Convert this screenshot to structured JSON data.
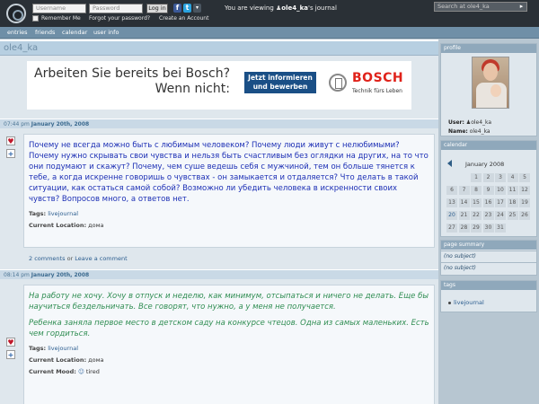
{
  "topbar": {
    "username_placeholder": "Username",
    "password_placeholder": "Password",
    "login_label": "Log in",
    "remember_label": "Remember Me",
    "forgot_label": "Forgot your password?",
    "create_label": "Create an Account",
    "viewing_prefix": "You are viewing",
    "viewing_user": "ole4_ka",
    "viewing_suffix": "'s journal",
    "search_placeholder": "Search at ole4_ka"
  },
  "nav": {
    "items": [
      "entries",
      "friends",
      "calendar",
      "user info"
    ]
  },
  "journal_title": "ole4_ka",
  "ad": {
    "headline_1": "Arbeiten Sie bereits bei Bosch?",
    "headline_2": "Wenn nicht:",
    "button_line_1": "Jetzt informieren",
    "button_line_2": "und bewerben",
    "brand": "BOSCH",
    "brand_tagline": "Technik fürs Leben"
  },
  "entries": [
    {
      "time": "07:44 pm",
      "date": "January 20th, 2008",
      "text": "Почему не всегда можно быть с любимым человеком? Почему люди живут с нелюбимыми? Почему нужно скрывать свои чувства и нельзя быть счастливым без оглядки на других, на то что они подумают и скажут?  Почему,  чем суше ведешь себя с мужчиной, тем он больше тянется к тебе, а когда искренне говоришь о чувствах - он замыкается и отдаляется? Что делать в такой ситуации, как остаться самой собой? Возможно ли убедить человека в искренности своих чувств? Вопросов много, а ответов нет.",
      "tags_label": "Tags:",
      "tags": "livejournal",
      "location_label": "Current Location:",
      "location": "дома",
      "comments": "2 comments",
      "or": "or",
      "leave_comment": "Leave a comment"
    },
    {
      "time": "08:14 pm",
      "date": "January 20th, 2008",
      "text_1": "На работу не хочу. Хочу в отпуск и неделю, как минимум, отсыпаться и ничего не делать. Еще бы научиться бездельничать. Все говорят, что нужно, а у меня не получается.",
      "text_2": "Ребенка заняла первое место в детском саду на конкурсе чтецов. Одна из самых маленьких. Есть чем гордиться.",
      "tags_label": "Tags:",
      "tags": "livejournal",
      "location_label": "Current Location:",
      "location": "дома",
      "mood_label": "Current Mood:",
      "mood": "tired",
      "mood_icon": "tired-mood-icon"
    }
  ],
  "sidebar": {
    "profile": {
      "header": "profile",
      "user_label": "User:",
      "user": "ole4_ka",
      "name_label": "Name:",
      "name": "ole4_ka"
    },
    "calendar": {
      "header": "calendar",
      "month": "January 2008",
      "days": [
        "1",
        "2",
        "3",
        "4",
        "5",
        "6",
        "7",
        "8",
        "9",
        "10",
        "11",
        "12",
        "13",
        "14",
        "15",
        "16",
        "17",
        "18",
        "19",
        "20",
        "21",
        "22",
        "23",
        "24",
        "25",
        "26",
        "27",
        "28",
        "29",
        "30",
        "31"
      ]
    },
    "summary": {
      "header": "page summary",
      "items": [
        "(no subject)",
        "(no subject)"
      ]
    },
    "tags": {
      "header": "tags",
      "items": [
        "livejournal"
      ]
    }
  },
  "colors": {
    "accent": "#6f8fa7",
    "entry_text": "#1c2fb5",
    "italic_text": "#2f8d52",
    "bosch_red": "#e0221a"
  }
}
